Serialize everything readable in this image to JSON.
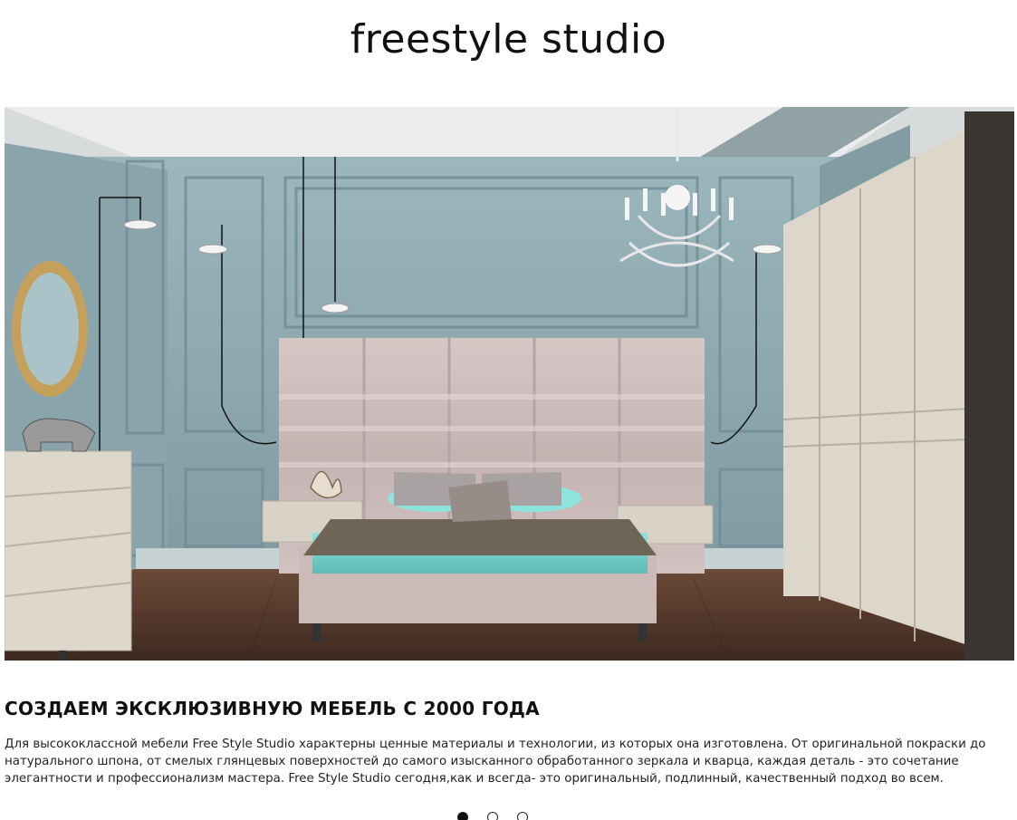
{
  "header": {
    "brand": "freestyle studio"
  },
  "hero": {
    "image_subject": "bedroom-interior-photo"
  },
  "content": {
    "headline": "СОЗДАЕМ ЭКСКЛЮЗИВНУЮ МЕБЕЛЬ С 2000 ГОДА",
    "description": "Для высококлассной мебели Free Style Studio характерны ценные материалы и технологии, из которых она изготовлена. От оригинальной покраски до натурального шпона, от смелых глянцевых поверхностей до самого изысканного обработанного зеркала и кварца, каждая деталь - это сочетание элегантности и профессионализм мастера. Free Style Studio сегодня,как и всегда- это оригинальный, подлинный, качественный подход во всем."
  },
  "carousel": {
    "slide_count": 3,
    "active_index": 0
  },
  "colors": {
    "wall": "#8fa9b1",
    "floor": "#5a3a2a",
    "headboard": "#cdbdbb",
    "bedding": "#7fd3cf",
    "furniture": "#ddd7cc",
    "text": "#111111"
  }
}
